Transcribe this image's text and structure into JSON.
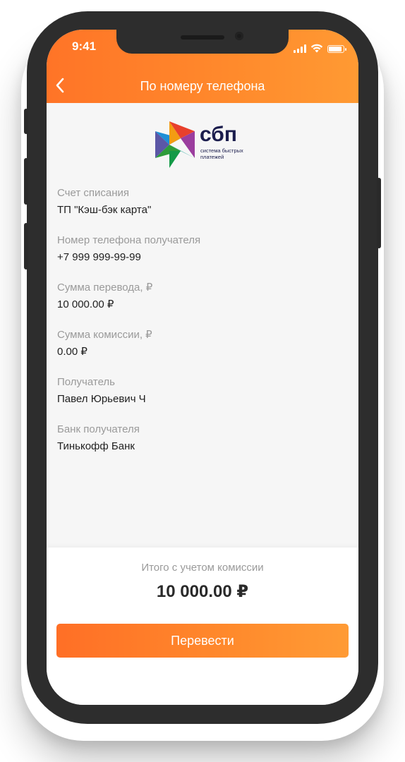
{
  "status_bar": {
    "time": "9:41",
    "battery_level": 0.9
  },
  "header": {
    "title": "По номеру телефона",
    "back_icon": "chevron-left-icon"
  },
  "logo": {
    "name": "сбп",
    "subtitle": "система быстрых платежей"
  },
  "fields": [
    {
      "label": "Счет списания",
      "value": "ТП \"Кэш-бэк карта\""
    },
    {
      "label": "Номер телефона получателя",
      "value": "+7 999 999-99-99"
    },
    {
      "label": "Сумма перевода, ₽",
      "value": "10 000.00 ₽"
    },
    {
      "label": "Сумма комиссии, ₽",
      "value": "0.00 ₽"
    },
    {
      "label": "Получатель",
      "value": "Павел Юрьевич Ч"
    },
    {
      "label": "Банк получателя",
      "value": "Тинькофф Банк"
    }
  ],
  "summary": {
    "total_label": "Итого с учетом комиссии",
    "total_value": "10 000.00 ₽"
  },
  "actions": {
    "submit_label": "Перевести"
  },
  "colors": {
    "accent": "#ff7f2a",
    "brand_text": "#1b1d4d"
  }
}
